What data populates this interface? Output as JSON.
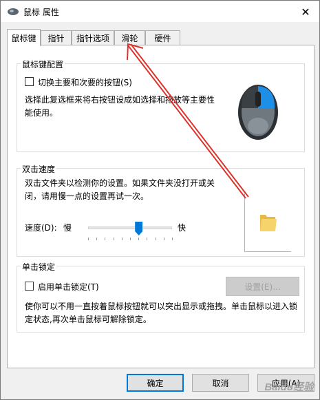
{
  "window": {
    "title": "鼠标 属性",
    "close_glyph": "✕"
  },
  "tabs": [
    {
      "label": "鼠标键",
      "active": true
    },
    {
      "label": "指针",
      "active": false
    },
    {
      "label": "指针选项",
      "active": false
    },
    {
      "label": "滑轮",
      "active": false
    },
    {
      "label": "硬件",
      "active": false
    }
  ],
  "button_config": {
    "title": "鼠标键配置",
    "checkbox_label": "切换主要和次要的按钮(S)",
    "checked": false,
    "description": "选择此复选框来将右按钮设成如选择和拖放等主要性能使用。",
    "icon": "mouse-icon"
  },
  "double_click": {
    "title": "双击速度",
    "description": "双击文件夹以检测你的设置。如果文件夹没打开或关闭，请用慢一点的设置再试一次。",
    "speed_label": "速度(D):",
    "slow_label": "慢",
    "fast_label": "快",
    "speed_value": 0.6,
    "test_icon": "folder-icon"
  },
  "click_lock": {
    "title": "单击锁定",
    "checkbox_label": "启用单击锁定(T)",
    "checked": false,
    "settings_label": "设置(E)...",
    "description": "使你可以不用一直按着鼠标按钮就可以突出显示或拖拽。单击鼠标以进入锁定状态,再次单击鼠标可解除锁定。"
  },
  "footer": {
    "ok_label": "确定",
    "cancel_label": "取消",
    "apply_label": "应用(A)"
  },
  "watermark": "Baidu经验",
  "colors": {
    "accent": "#0078d7",
    "annotation_arrow": "#d9332b"
  }
}
